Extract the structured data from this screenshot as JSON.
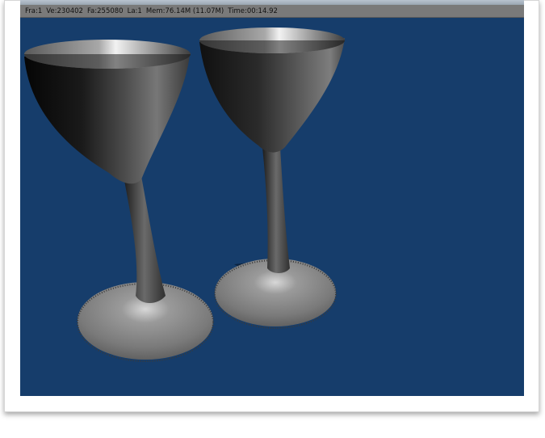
{
  "status_bar": {
    "frame": "Fra:1",
    "vertices": "Ve:230402",
    "faces": "Fa:255080",
    "lamps": "La:1",
    "memory": "Mem:76.14M (11.07M)",
    "time": "Time:00:14.92"
  },
  "render": {
    "background_color": "#163d6b",
    "objects": [
      "wine-glass-left",
      "wine-glass-right"
    ]
  }
}
